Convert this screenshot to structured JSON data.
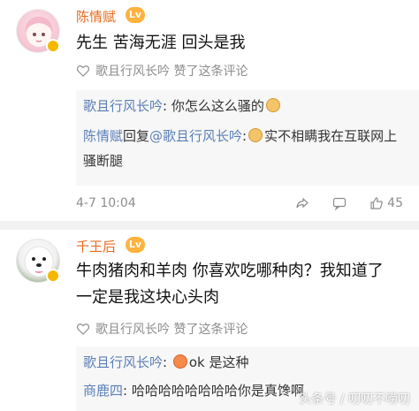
{
  "comment1": {
    "username": "陈情赋",
    "level_badge": "Lv",
    "text": "先生 苦海无涯 回头是我",
    "meta": "歌且行风长吟 赞了这条评论",
    "replies": [
      {
        "name": "歌且行风长吟",
        "sep": ":",
        "text": "你怎么这么骚的"
      },
      {
        "name": "陈情赋",
        "middle": "回复",
        "target": "@歌且行风长吟",
        "sep": ":",
        "text": "实不相瞒我在互联网上骚断腿"
      }
    ],
    "time": "4-7 10:04",
    "like_count": "45"
  },
  "comment2": {
    "username": "千王后",
    "level_badge": "Lv",
    "text": "牛肉猪肉和羊肉 你喜欢吃哪种肉？我知道了 一定是我这块心头肉",
    "meta": "歌且行风长吟 赞了这条评论",
    "replies": [
      {
        "name": "歌且行风长吟",
        "sep": ":",
        "text": "ok 是这种"
      },
      {
        "name": "商鹿四",
        "sep": ":",
        "text": "哈哈哈哈哈哈哈哈你是真馋啊"
      }
    ]
  },
  "watermark": "头条号 / 叨叨不唠叨",
  "colors": {
    "username": "#e86b1e",
    "reply_name": "#5b7fb6",
    "meta": "#8d8d8d",
    "badge": "#f5b800"
  },
  "icons": [
    "heart-icon",
    "share-icon",
    "comment-icon",
    "like-icon"
  ]
}
